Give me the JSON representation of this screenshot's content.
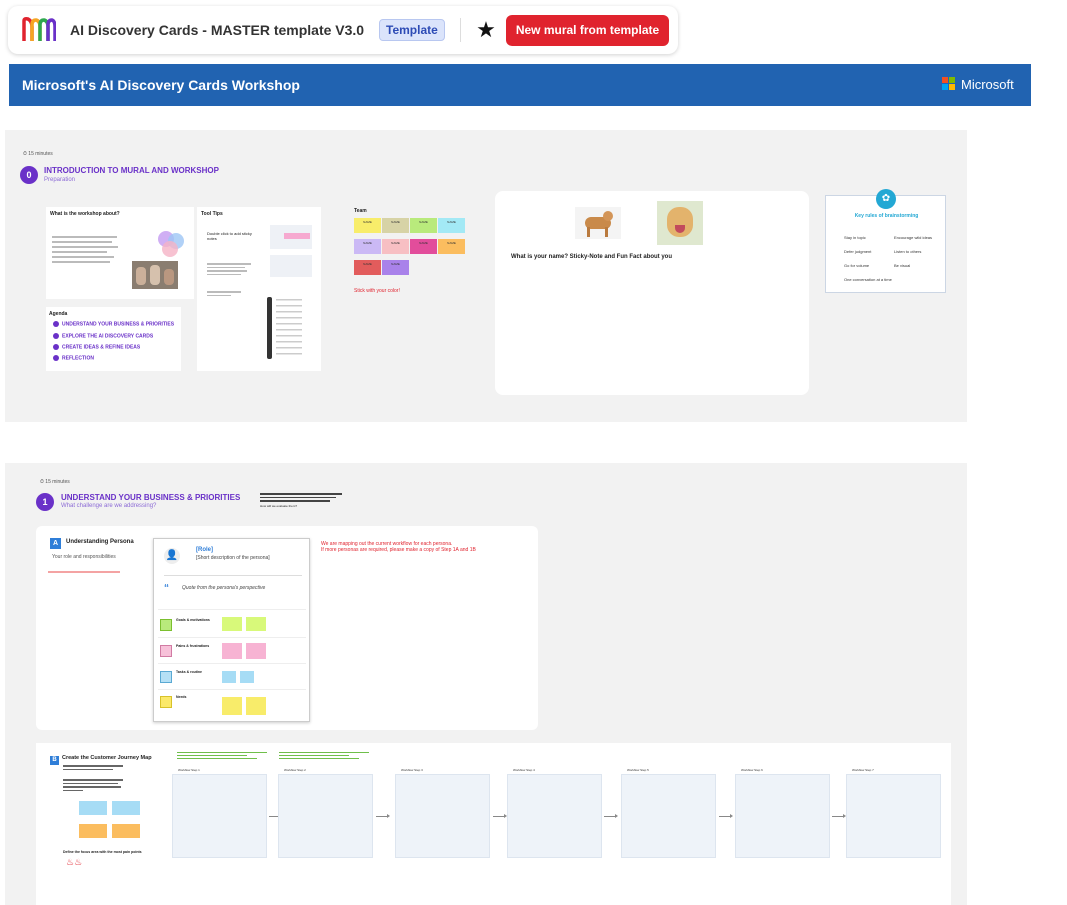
{
  "topbar": {
    "title": "AI Discovery Cards -  MASTER template V3.0",
    "badge": "Template",
    "new_mural_label": "New mural from template"
  },
  "banner": {
    "title": "Microsoft's AI Discovery Cards Workshop",
    "brand": "Microsoft"
  },
  "colors": {
    "banner_blue": "#2163b1",
    "primary_red": "#e0232e",
    "section_purple": "#6a31c8"
  },
  "icons": [
    "mural-logo-icon",
    "star-icon",
    "microsoft-logo-icon",
    "clock-icon",
    "user-icon",
    "quote-icon",
    "brain-icon"
  ],
  "intro": {
    "time": "15 minutes",
    "number": "0",
    "title": "INTRODUCTION TO MURAL AND WORKSHOP",
    "subtitle": "Preparation",
    "workshop_card_title": "What is the workshop about?",
    "tool_tips_title": "Tool Tips",
    "tool_tip_1": "Double click to add sticky notes",
    "agenda_title": "Agenda",
    "agenda": [
      "UNDERSTAND YOUR BUSINESS & PRIORITIES",
      "EXPLORE THE AI DISCOVERY CARDS",
      "CREATE IDEAS & REFINE IDEAS",
      "REFLECTION"
    ],
    "team_title": "Team",
    "team_sticky_label": "NAME",
    "stick_color_text": "Stick with your color!",
    "name_prompt": "What is your name? Sticky-Note and Fun Fact about you",
    "brainstorm_title": "Key rules of brainstorming",
    "brainstorm_rules": [
      "Stay in topic",
      "Encourage wild ideas",
      "Defer judgment",
      "Listen to others",
      "Go for volume",
      "Be visual",
      "One conversation at a time"
    ]
  },
  "section1": {
    "time": "15 minutes",
    "number": "1",
    "title": "UNDERSTAND YOUR BUSINESS & PRIORITIES",
    "subtitle": "What challenge are we addressing?",
    "side_note": "How will we evaluate them?",
    "persona": {
      "letter": "A",
      "title": "Understanding Persona",
      "subtitle": "Your role and responsibilities",
      "role": "[Role]",
      "role_desc": "[Short description of the persona]",
      "quote": "Quote from the persona's perspective",
      "rows": [
        "Goals & motivations",
        "Pains & frustrations",
        "Tasks & routine",
        "Needs"
      ],
      "notice_1": "We are mapping out the current workflow for each persona.",
      "notice_2": "If more personas are required, please make a copy of Step 1A and 1B"
    },
    "journey": {
      "letter": "B",
      "title": "Create the Customer Journey Map",
      "steps": [
        "Workflow Step 1",
        "Workflow Step 2",
        "Workflow Step 3",
        "Workflow Step 4",
        "Workflow Step 5",
        "Workflow Step 6",
        "Workflow Step 7"
      ],
      "focus_text": "Define the focus area with the most pain points"
    }
  }
}
